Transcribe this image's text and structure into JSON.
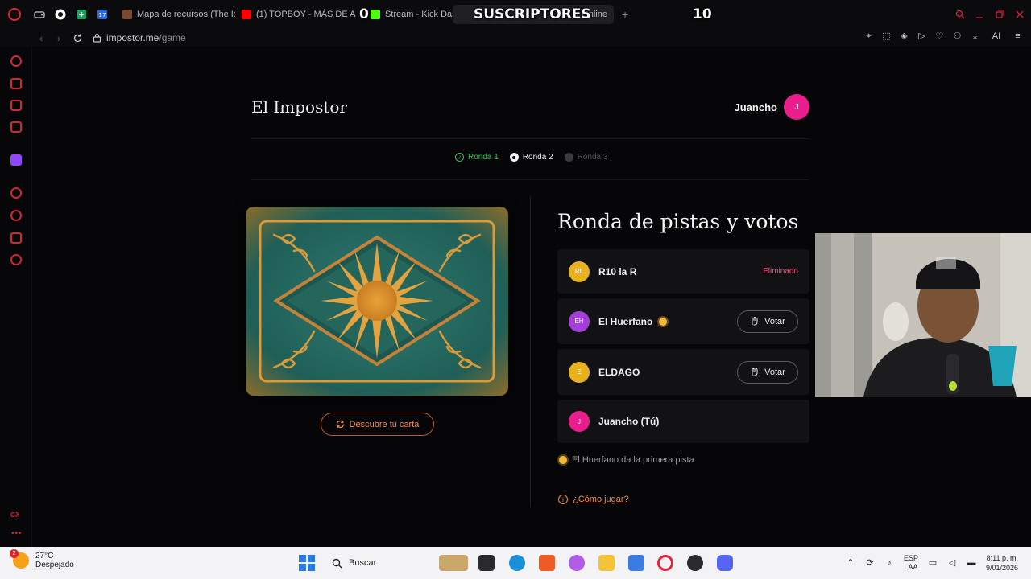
{
  "browser": {
    "tabs": [
      {
        "title": "Mapa de recursos (The Isla",
        "fav_color": "#7a4a30"
      },
      {
        "title": "(1) TOPBOY - MÁS DE A",
        "fav_color": "#ff0000"
      },
      {
        "title": "Stream - Kick Dashb",
        "fav_color": "#53fc18"
      },
      {
        "title": "r Online",
        "fav_color": "#d3243b",
        "active": true
      }
    ],
    "overlay": {
      "count_left": "0",
      "label": "SUSCRIPTORES",
      "count_right": "10"
    },
    "new_tab_symbol": "+",
    "url_host": "impostor.me",
    "url_path": "/game",
    "ai_label": "AI"
  },
  "page": {
    "site_title": "El Impostor",
    "user": {
      "name": "Juancho",
      "initial": "J"
    },
    "rounds": [
      {
        "label": "Ronda 1",
        "state": "done"
      },
      {
        "label": "Ronda 2",
        "state": "current"
      },
      {
        "label": "Ronda 3",
        "state": "future"
      }
    ],
    "reveal_button": "Descubre tu carta",
    "heading": "Ronda de pistas y votos",
    "players": [
      {
        "initials": "RL",
        "name": "R10 la R",
        "color": "#e8b21e",
        "status": "Eliminado"
      },
      {
        "initials": "EH",
        "name": "El Huerfano",
        "color": "#a43fd8",
        "vote": "Votar",
        "first_clue": true
      },
      {
        "initials": "E",
        "name": "ELDAGO",
        "color": "#e8b21e",
        "vote": "Votar"
      },
      {
        "initials": "J",
        "name": "Juancho (Tú)",
        "color": "#e91e8c"
      }
    ],
    "hint": "El Huerfano da la primera pista",
    "how_to_play": "¿Cómo jugar?"
  },
  "taskbar": {
    "temperature": "27°C",
    "weather": "Despejado",
    "weather_badge": "2",
    "search_placeholder": "Buscar",
    "lang_top": "ESP",
    "lang_bottom": "LAA",
    "time": "8:11 p. m.",
    "date": "9/01/2026"
  },
  "sidebar": {
    "gx_label": "GX"
  }
}
